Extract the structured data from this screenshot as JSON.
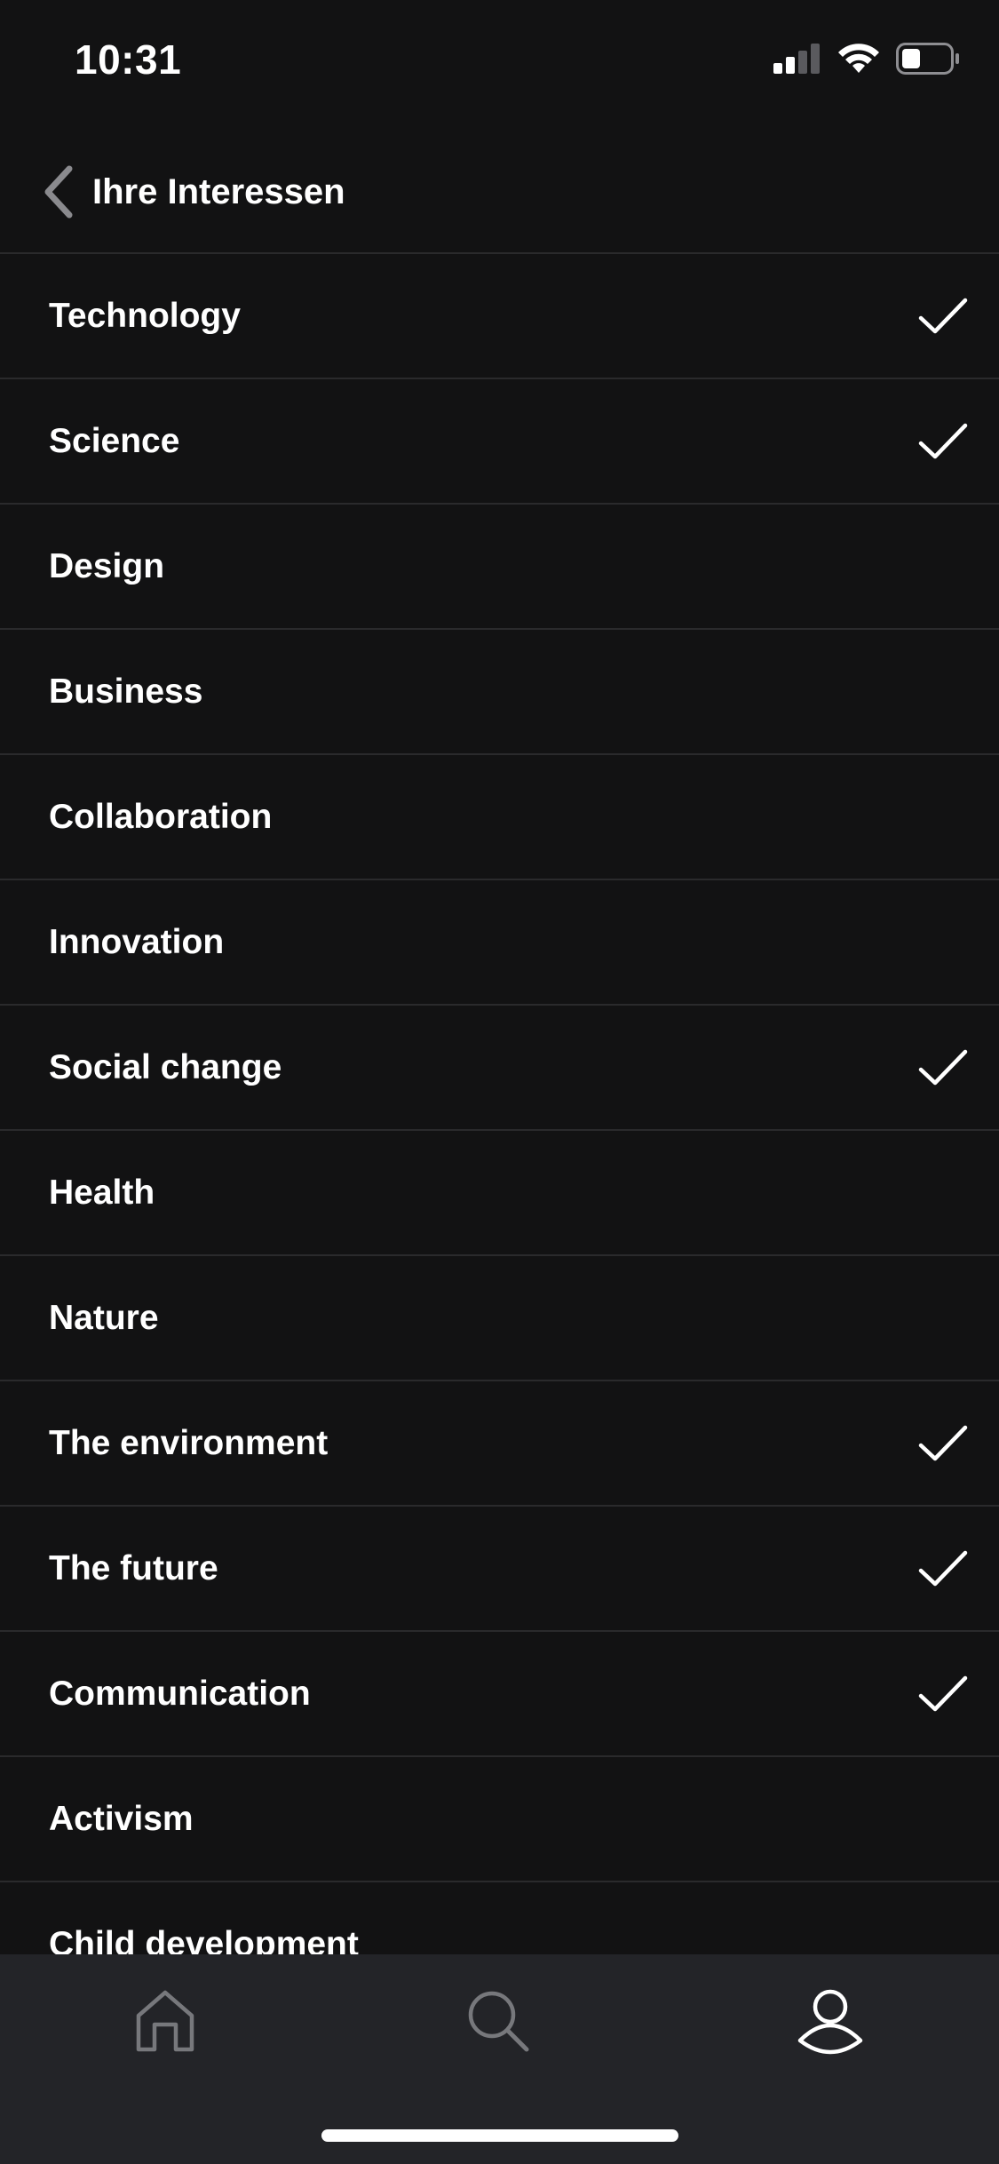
{
  "status_bar": {
    "time": "10:31",
    "signal_icon": "cellular-signal-icon",
    "wifi_icon": "wifi-icon",
    "battery_icon": "battery-icon"
  },
  "header": {
    "back_icon": "chevron-left-icon",
    "title": "Ihre Interessen"
  },
  "interests": [
    {
      "label": "Technology",
      "selected": true
    },
    {
      "label": "Science",
      "selected": true
    },
    {
      "label": "Design",
      "selected": false
    },
    {
      "label": "Business",
      "selected": false
    },
    {
      "label": "Collaboration",
      "selected": false
    },
    {
      "label": "Innovation",
      "selected": false
    },
    {
      "label": "Social change",
      "selected": true
    },
    {
      "label": "Health",
      "selected": false
    },
    {
      "label": "Nature",
      "selected": false
    },
    {
      "label": "The environment",
      "selected": true
    },
    {
      "label": "The future",
      "selected": true
    },
    {
      "label": "Communication",
      "selected": true
    },
    {
      "label": "Activism",
      "selected": false
    },
    {
      "label": "Child development",
      "selected": false
    }
  ],
  "tab_bar": {
    "tabs": [
      {
        "name": "home",
        "icon": "home-icon",
        "active": false
      },
      {
        "name": "search",
        "icon": "search-icon",
        "active": false
      },
      {
        "name": "profile",
        "icon": "profile-icon",
        "active": true
      }
    ]
  },
  "colors": {
    "background": "#121213",
    "divider": "#2a2a2c",
    "tab_bar_background": "#232428",
    "inactive_icon": "#77787c",
    "active_icon": "#ffffff",
    "text": "#ffffff"
  }
}
